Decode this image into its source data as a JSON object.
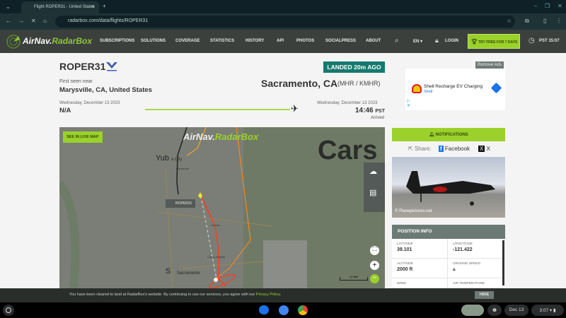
{
  "browser": {
    "tab_title": "Flight ROPER31 - United States",
    "url": "radarbox.com/data/flights/ROPER31"
  },
  "nav": {
    "logo_a": "AirNav",
    "logo_b": "RadarBox",
    "items": [
      "SUBSCRIPTIONS",
      "SOLUTIONS",
      "COVERAGE",
      "STATISTICS",
      "HISTORY",
      "API",
      "PHOTOS",
      "SOCIALPRESS",
      "ABOUT"
    ],
    "lang": "EN ▾",
    "login": "LOGIN",
    "try_free": "TRY FREE FOR 7 DAYS",
    "time": "PST 15:07"
  },
  "flight": {
    "callsign": "ROPER31",
    "status": "LANDED 20m AGO",
    "origin_label": "First seen near",
    "origin": "Marysville, CA, United States",
    "origin_date": "Wednesday, December 13 2023",
    "origin_time": "N/A",
    "dest": "Sacramento, CA",
    "dest_codes": "(MHR / KMHR)",
    "dest_date": "Wednesday, December 13 2023",
    "dest_time": "14:46",
    "dest_tz": "PST",
    "dest_status": "Arrived"
  },
  "ad": {
    "remove": "Remove Ads",
    "title": "Shell Recharge EV Charging",
    "brand": "Shell"
  },
  "map": {
    "live_btn": "SEE IN LIVE MAP",
    "watermark_a": "AirNav",
    "watermark_b": "RadarBox",
    "flight_label": "ROPER31",
    "places": [
      "Yub",
      "a City",
      "Olivehurst",
      "Lincoln",
      "Citrus Heights",
      "Sacramento",
      "S",
      "Cars"
    ],
    "scale": "10 NM"
  },
  "side": {
    "notifications": "NOTIFICATIONS",
    "share": "Share:",
    "facebook": "Facebook",
    "x": "X",
    "photo_credit": "© Planepictures.net"
  },
  "position": {
    "title": "POSITION INFO",
    "latitude_label": "LATITUDE",
    "latitude": "39.101",
    "longitude_label": "LONGITUDE",
    "longitude": "-121.422",
    "altitude_label": "ALTITUDE",
    "altitude": "2000 ft",
    "ground_speed_label": "GROUND SPEED",
    "wind_label": "WIND",
    "air_temp_label": "AIR TEMPERATURE"
  },
  "cookie": {
    "text": "You have been cleared to land at RadarBox's website. By continuing to use our services, you agree with our ",
    "link": "Privacy Policy",
    "suffix": ".",
    "hide": "HIDE"
  },
  "shelf": {
    "date": "Dec 13",
    "time": "3:07"
  },
  "colors": {
    "accent": "#9bd12a",
    "landed": "#157a6e",
    "track": "#ff3b1f"
  }
}
